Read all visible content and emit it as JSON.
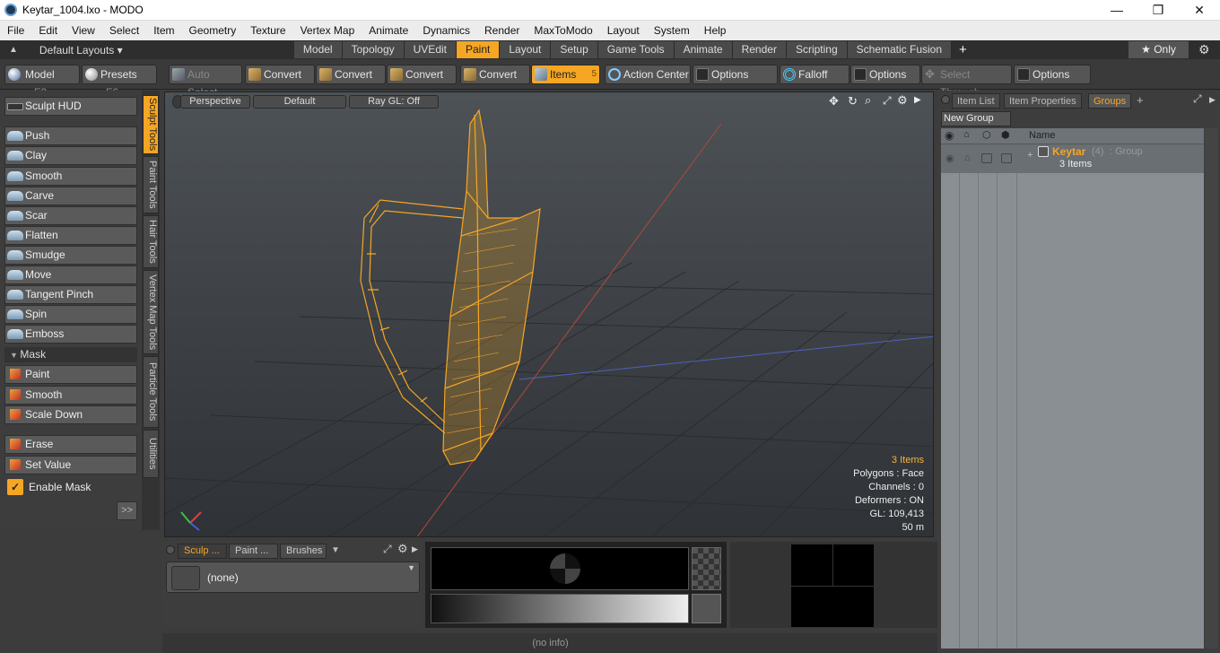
{
  "window": {
    "title": "Keytar_1004.lxo - MODO",
    "minimize": "—",
    "maximize": "❐",
    "close": "✕"
  },
  "menu": [
    "File",
    "Edit",
    "View",
    "Select",
    "Item",
    "Geometry",
    "Texture",
    "Vertex Map",
    "Animate",
    "Dynamics",
    "Render",
    "MaxToModo",
    "Layout",
    "System",
    "Help"
  ],
  "layouts": {
    "default": "Default Layouts ▾",
    "tabs": [
      "Model",
      "Topology",
      "UVEdit",
      "Paint",
      "Layout",
      "Setup",
      "Game Tools",
      "Animate",
      "Render",
      "Scripting",
      "Schematic Fusion"
    ],
    "active": "Paint",
    "add": "+",
    "only": "★ Only",
    "gear": "⚙"
  },
  "toolbar": {
    "model": "Model",
    "model_key": "F2",
    "presets": "Presets",
    "presets_key": "F6",
    "auto_select": "Auto Select",
    "convert1": "Convert",
    "convert2": "Convert",
    "convert3": "Convert",
    "convert4": "Convert",
    "items": "Items",
    "items_key": "5",
    "action_center": "Action Center",
    "options1": "Options",
    "falloff": "Falloff",
    "options2": "Options",
    "select_through": "Select Through",
    "options3": "Options"
  },
  "sculpt": {
    "hud": "Sculpt HUD",
    "tools": [
      "Push",
      "Clay",
      "Smooth",
      "Carve",
      "Scar",
      "Flatten",
      "Smudge",
      "Move",
      "Tangent Pinch",
      "Spin",
      "Emboss"
    ],
    "mask_header": "Mask",
    "mask_tools": [
      "Paint",
      "Smooth",
      "Scale Down"
    ],
    "erase": "Erase",
    "set_value": "Set Value",
    "enable_mask": "Enable Mask",
    "more": ">>"
  },
  "vtabs": [
    "Sculpt Tools",
    "Paint Tools",
    "Hair Tools",
    "Vertex Map Tools",
    "Particle Tools",
    "Utilities"
  ],
  "viewport": {
    "view": "Perspective",
    "shading": "Default",
    "raygl": "Ray GL: Off"
  },
  "stats": {
    "items": "3 Items",
    "polygons": "Polygons : Face",
    "channels": "Channels : 0",
    "deformers": "Deformers : ON",
    "gl": "GL: 109,413",
    "scale": "50 m"
  },
  "bottom": {
    "tabs": [
      "Sculp ...",
      "Paint ...",
      "Brushes"
    ],
    "brush": "(none)"
  },
  "status": "(no info)",
  "right": {
    "tabs": [
      "Item List",
      "Item Properties",
      "Groups"
    ],
    "active": "Groups",
    "add": "+",
    "new_group": "New Group",
    "col_name": "Name",
    "group_name": "Keytar",
    "group_count": "(4)",
    "group_type": ": Group",
    "group_items": "3 Items"
  },
  "colors": {
    "accent": "#f5a623",
    "wire": "#f5a623"
  }
}
